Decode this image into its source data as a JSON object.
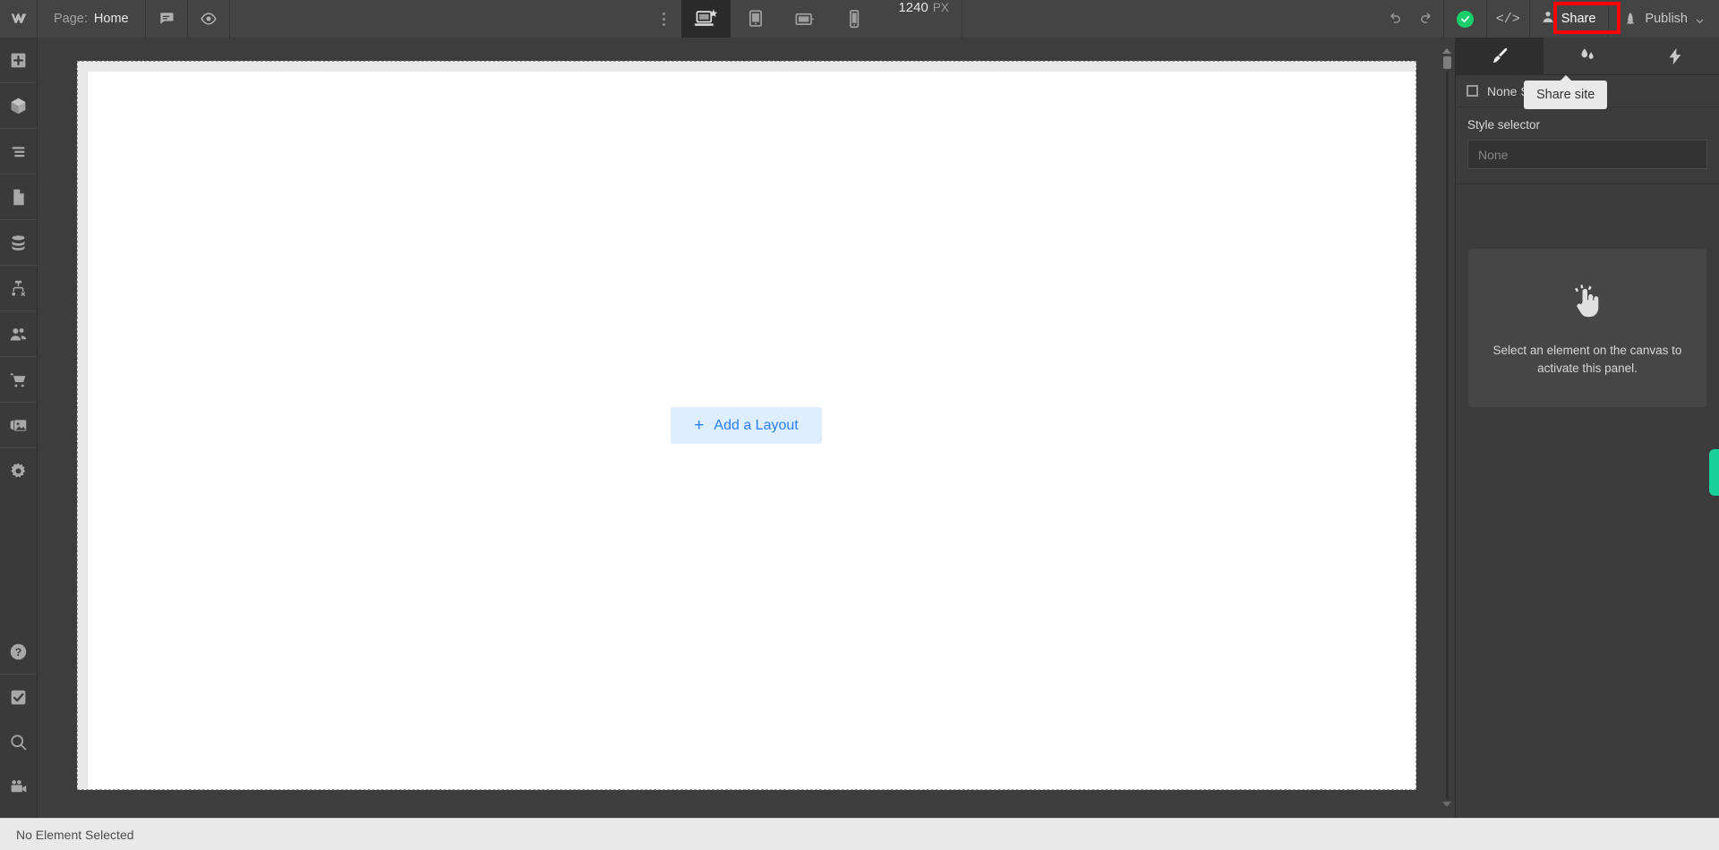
{
  "topbar": {
    "logo_icon": "webflow-logo-icon",
    "page_label": "Page:",
    "page_name": "Home",
    "comments_icon": "comment-bubble-icon",
    "preview_icon": "eye-preview-icon",
    "more_menu_icon": "three-dots-vertical-icon",
    "devices": [
      {
        "name": "desktop",
        "icon": "desktop-star-icon",
        "active": true
      },
      {
        "name": "tablet-portrait",
        "icon": "tablet-portrait-icon",
        "active": false
      },
      {
        "name": "tablet-landscape",
        "icon": "tablet-landscape-icon",
        "active": false
      },
      {
        "name": "mobile",
        "icon": "mobile-phone-icon",
        "active": false
      }
    ],
    "viewport_width": "1240",
    "viewport_unit": "PX",
    "undo_icon": "undo-arrow-icon",
    "redo_icon": "redo-arrow-icon",
    "save_status_icon": "green-check-saved-icon",
    "code_icon": "code-brackets-icon",
    "share_icon": "person-share-icon",
    "share_label": "Share",
    "publish_icon": "rocket-icon",
    "publish_label": "Publish",
    "publish_chevron_icon": "chevron-down-icon"
  },
  "highlight": {
    "target": "Share",
    "color": "#ff0000"
  },
  "tooltip": {
    "text": "Share site"
  },
  "sidebar": {
    "top_items": [
      {
        "name": "add-elements",
        "icon": "plus-box-icon"
      },
      {
        "name": "components",
        "icon": "cube-icon"
      },
      {
        "name": "navigator",
        "icon": "layers-lines-icon"
      },
      {
        "name": "pages",
        "icon": "page-file-icon"
      },
      {
        "name": "cms",
        "icon": "database-icon"
      },
      {
        "name": "logic",
        "icon": "sitemap-node-icon"
      },
      {
        "name": "users",
        "icon": "people-icon"
      },
      {
        "name": "ecommerce",
        "icon": "shopping-cart-icon"
      },
      {
        "name": "assets",
        "icon": "image-stack-icon"
      },
      {
        "name": "settings",
        "icon": "gear-icon"
      }
    ],
    "bottom_items": [
      {
        "name": "help",
        "icon": "question-circle-icon"
      },
      {
        "name": "audit",
        "icon": "checkmark-box-icon"
      },
      {
        "name": "search",
        "icon": "magnifier-icon"
      },
      {
        "name": "video",
        "icon": "video-camera-icon"
      }
    ]
  },
  "canvas": {
    "add_layout_plus": "+",
    "add_layout_label": "Add a Layout",
    "accent_color": "#2b7fff",
    "button_bg": "#dceeff"
  },
  "right_panel": {
    "tabs": [
      {
        "name": "style",
        "icon": "paintbrush-icon",
        "active": true
      },
      {
        "name": "interactions",
        "icon": "water-drops-icon",
        "active": false
      },
      {
        "name": "effects",
        "icon": "lightning-bolt-icon",
        "active": false
      }
    ],
    "selection_icon": "empty-square-icon",
    "selection_label": "None Selected",
    "style_selector_caption": "Style selector",
    "style_selector_value": "None",
    "empty_state_icon": "pointing-hand-click-icon",
    "empty_state_message": "Select an element on the canvas to activate this panel."
  },
  "green_tab": {
    "name": "feedback-tab",
    "color": "#17d39a"
  },
  "statusbar": {
    "text": "No Element Selected"
  }
}
